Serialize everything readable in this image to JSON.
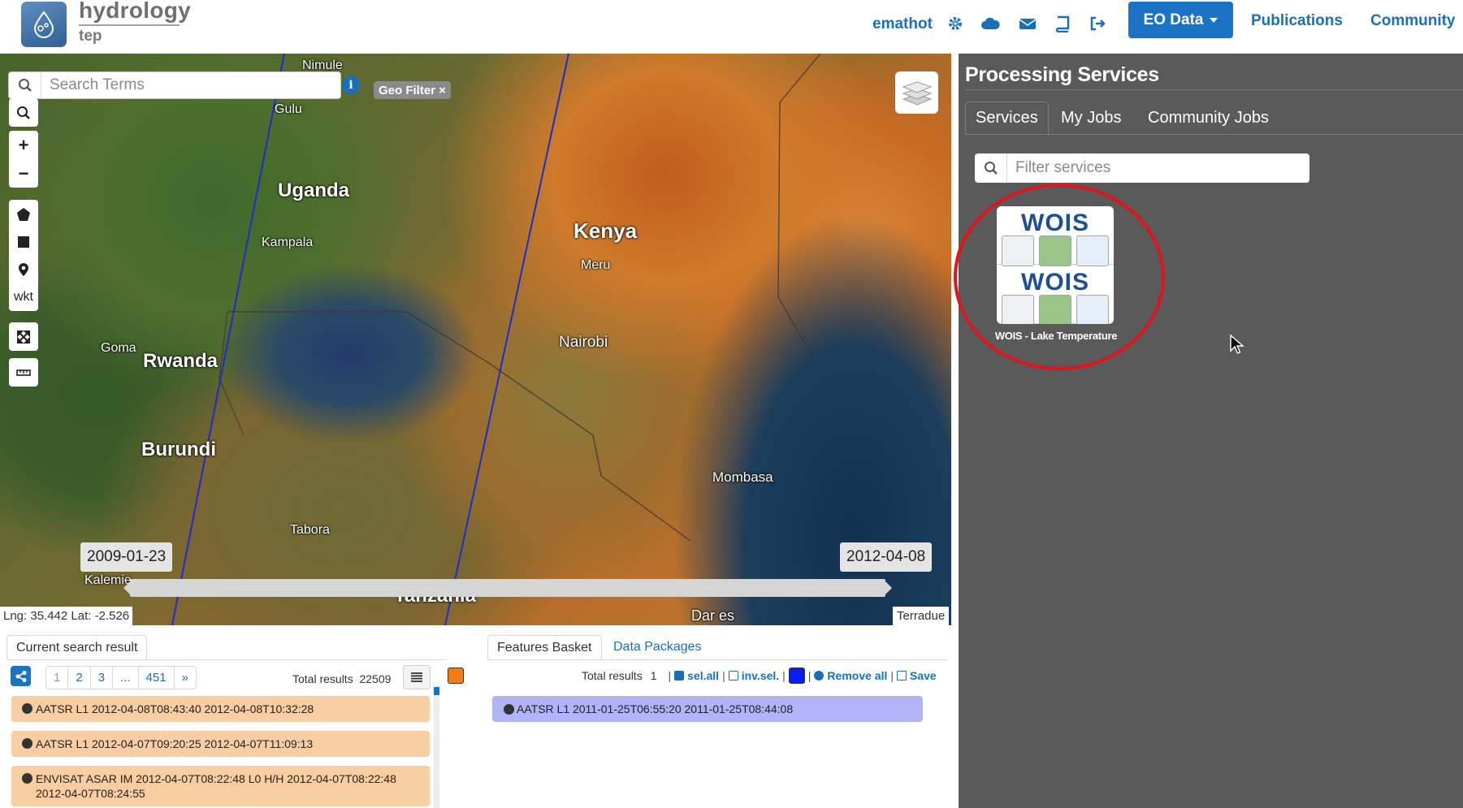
{
  "topbar": {
    "logo_title": "hydrology",
    "logo_subtitle": "tep",
    "username": "emathot",
    "icons": [
      "gear-icon",
      "cloud-icon",
      "envelope-icon",
      "book-icon",
      "sign-out-icon"
    ],
    "eo_data_label": "EO Data",
    "links": [
      "Publications",
      "Community"
    ]
  },
  "map": {
    "search_placeholder": "Search Terms",
    "geo_filter_label": "Geo Filter ×",
    "tools": {
      "wkt_label": "wkt"
    },
    "labels": {
      "countries": [
        "Uganda",
        "Kenya",
        "Rwanda",
        "Burundi",
        "Tanzania"
      ],
      "cities": [
        "Nimule",
        "Gulu",
        "Kampala",
        "Meru",
        "Nairobi",
        "Goma",
        "Mombasa",
        "Tabora",
        "Kalemie",
        "Dar es"
      ]
    },
    "time_start": "2009-01-23",
    "time_end": "2012-04-08",
    "coordinates": "Lng: 35.442 Lat: -2.526",
    "attribution": "Terradue"
  },
  "search_results": {
    "tab_label": "Current search result",
    "pages": [
      "1",
      "2",
      "3",
      "...",
      "451",
      "»"
    ],
    "total_label": "Total results",
    "total_value": "22509",
    "series_color": "#f07d13",
    "rows": [
      {
        "text": "AATSR L1 2012-04-08T08:43:40 2012-04-08T10:32:28"
      },
      {
        "text": "AATSR L1 2012-04-07T09:20:25 2012-04-07T11:09:13"
      },
      {
        "text": "ENVISAT ASAR IM 2012-04-07T08:22:48 L0 H/H 2012-04-07T08:22:48 2012-04-07T08:24:55"
      }
    ]
  },
  "basket": {
    "tabs": [
      "Features Basket",
      "Data Packages"
    ],
    "total_label": "Total results",
    "total_value": "1",
    "actions": {
      "sel_all": "sel.all",
      "inv_sel": "inv.sel.",
      "remove_all": "Remove all",
      "save": "Save"
    },
    "basket_color": "#0a1cf0",
    "rows": [
      {
        "text": "AATSR L1 2011-01-25T06:55:20 2011-01-25T08:44:08"
      }
    ]
  },
  "processing": {
    "title": "Processing Services",
    "tabs": [
      "Services",
      "My Jobs",
      "Community Jobs"
    ],
    "filter_placeholder": "Filter services",
    "services": [
      {
        "logo_word": "WOIS",
        "name": "WOIS - Lake Temperature"
      }
    ],
    "highlight_color": "#e0151b"
  }
}
